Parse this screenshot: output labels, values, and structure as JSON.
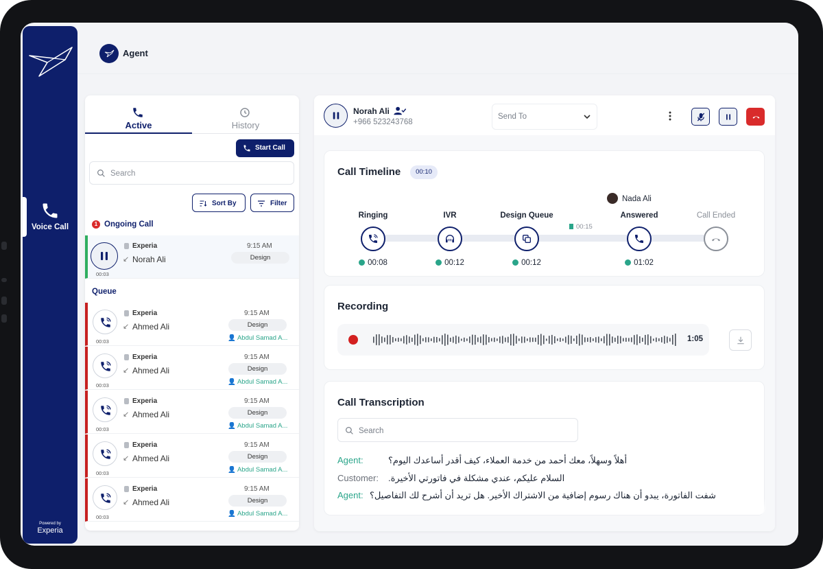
{
  "sidebar": {
    "nav_label": "Voice Call",
    "powered_by": "Powered by",
    "brand": "Experia"
  },
  "header": {
    "agent_label": "Agent"
  },
  "left_panel": {
    "tabs": [
      {
        "label": "Active",
        "icon": "phone-icon"
      },
      {
        "label": "History",
        "icon": "history-icon"
      }
    ],
    "start_call": "Start Call",
    "search_placeholder": "Search",
    "sort_by": "Sort By",
    "filter": "Filter",
    "ongoing_title": "Ongoing Call",
    "ongoing_count": "1",
    "queue_title": "Queue",
    "ongoing": {
      "company": "Experia",
      "name": "Norah Ali",
      "time": "9:15 AM",
      "tag": "Design",
      "duration": "00:03"
    },
    "queue": [
      {
        "company": "Experia",
        "name": "Ahmed Ali",
        "time": "9:15 AM",
        "tag": "Design",
        "assignee": "Abdul Samad A...",
        "duration": "00:03"
      },
      {
        "company": "Experia",
        "name": "Ahmed Ali",
        "time": "9:15 AM",
        "tag": "Design",
        "assignee": "Abdul Samad A...",
        "duration": "00:03"
      },
      {
        "company": "Experia",
        "name": "Ahmed Ali",
        "time": "9:15 AM",
        "tag": "Design",
        "assignee": "Abdul Samad A...",
        "duration": "00:03"
      },
      {
        "company": "Experia",
        "name": "Ahmed Ali",
        "time": "9:15 AM",
        "tag": "Design",
        "assignee": "Abdul Samad A...",
        "duration": "00:03"
      },
      {
        "company": "Experia",
        "name": "Ahmed Ali",
        "time": "9:15 AM",
        "tag": "Design",
        "assignee": "Abdul Samad A...",
        "duration": "00:03"
      }
    ]
  },
  "call": {
    "caller_name": "Norah Ali",
    "caller_phone": "+966 523243768",
    "send_to_placeholder": "Send To"
  },
  "timeline": {
    "title": "Call Timeline",
    "elapsed": "00:10",
    "agent_name": "Nada Ali",
    "gap_time": "00:15",
    "steps": [
      {
        "label": "Ringing",
        "time": "00:08",
        "icon": "phone-ringing-icon"
      },
      {
        "label": "IVR",
        "time": "00:12",
        "icon": "headset-icon"
      },
      {
        "label": "Design Queue",
        "time": "00:12",
        "icon": "queue-icon"
      },
      {
        "label": "Answered",
        "time": "01:02",
        "icon": "phone-icon"
      },
      {
        "label": "Call Ended",
        "time": "",
        "icon": "hangup-icon"
      }
    ]
  },
  "recording": {
    "title": "Recording",
    "duration": "1:05"
  },
  "transcription": {
    "title": "Call Transcription",
    "search_placeholder": "Search",
    "lines": [
      {
        "speaker": "Agent:",
        "text": "أهلاً وسهلاً، معك أحمد من خدمة العملاء، كيف أقدر أساعدك اليوم؟"
      },
      {
        "speaker": "Customer:",
        "text": "السلام عليكم، عندي مشكلة في فاتورتي الأخيرة."
      },
      {
        "speaker": "Agent:",
        "text": "شفت الفاتورة، يبدو أن هناك رسوم إضافية من الاشتراك الأخير. هل تريد أن أشرح لك التفاصيل؟"
      }
    ]
  },
  "colors": {
    "brand": "#0e1f6b",
    "accent_green": "#2aa58a",
    "danger": "#d92b2b",
    "ongoing": "#2fae5f"
  }
}
